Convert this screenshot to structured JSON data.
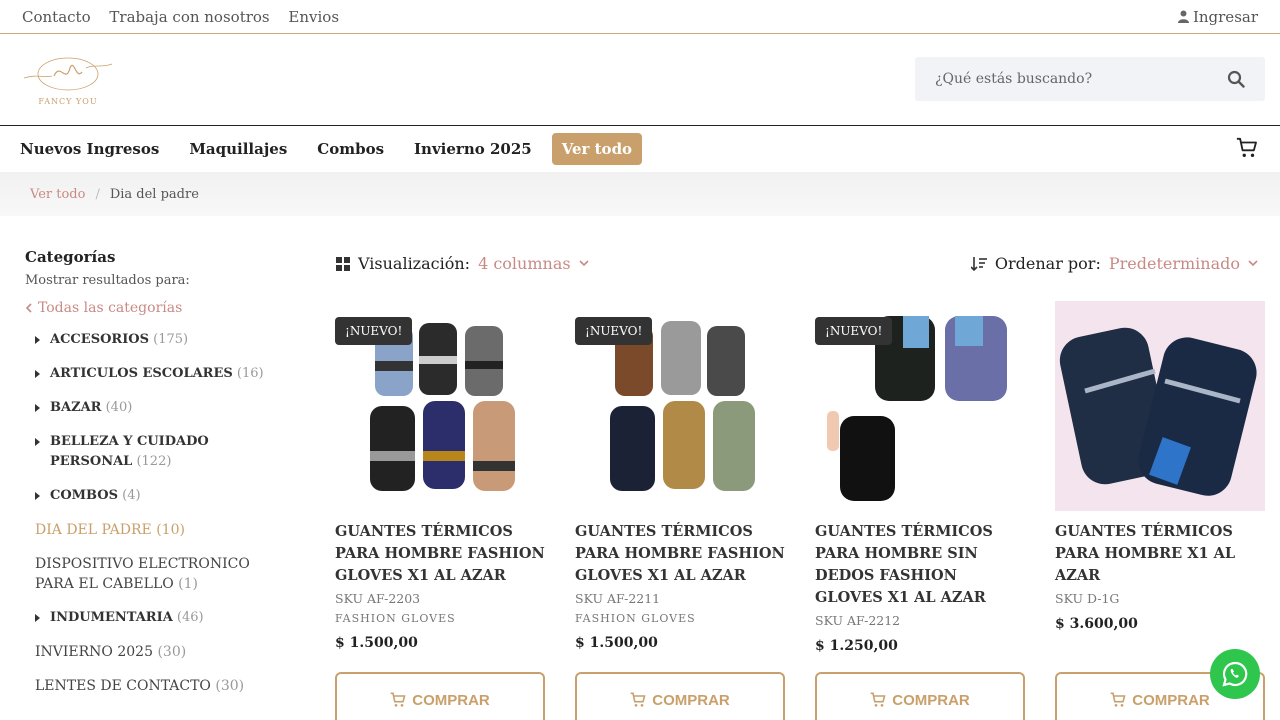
{
  "topbar": {
    "links": [
      "Contacto",
      "Trabaja con nosotros",
      "Envios"
    ],
    "login_label": "Ingresar"
  },
  "header": {
    "logo_text": "FANCY YOU",
    "search_placeholder": "¿Qué estás buscando?"
  },
  "nav": {
    "items": [
      "Nuevos Ingresos",
      "Maquillajes",
      "Combos",
      "Invierno 2025"
    ],
    "highlight": "Ver todo"
  },
  "breadcrumb": {
    "link": "Ver todo",
    "separator": "/",
    "current": "Dia del padre"
  },
  "sidebar": {
    "title": "Categorías",
    "subtitle": "Mostrar resultados para:",
    "all_label": "Todas las categorías",
    "categories": [
      {
        "name": "ACCESORIOS",
        "count": "(175)"
      },
      {
        "name": "ARTICULOS ESCOLARES",
        "count": "(16)"
      },
      {
        "name": "BAZAR",
        "count": "(40)"
      },
      {
        "name": "BELLEZA Y CUIDADO PERSONAL",
        "count": "(122)"
      },
      {
        "name": "COMBOS",
        "count": "(4)"
      },
      {
        "name": "DIA DEL PADRE",
        "count": "(10)"
      },
      {
        "name": "DISPOSITIVO ELECTRONICO PARA EL CABELLO",
        "count": "(1)"
      },
      {
        "name": "INDUMENTARIA",
        "count": "(46)"
      },
      {
        "name": "INVIERNO 2025",
        "count": "(30)"
      },
      {
        "name": "LENTES DE CONTACTO",
        "count": "(30)"
      }
    ]
  },
  "toolbar": {
    "view_label": "Visualización:",
    "view_value": "4 columnas",
    "order_label": "Ordenar por:",
    "order_value": "Predeterminado"
  },
  "products": [
    {
      "badge": "¡NUEVO!",
      "name": "GUANTES TÉRMICOS PARA HOMBRE FASHION GLOVES X1 AL AZAR",
      "sku": "SKU AF-2203",
      "brand": "FASHION GLOVES",
      "price": "$  1.500,00"
    },
    {
      "badge": "¡NUEVO!",
      "name": "GUANTES TÉRMICOS PARA HOMBRE FASHION GLOVES X1 AL AZAR",
      "sku": "SKU AF-2211",
      "brand": "FASHION GLOVES",
      "price": "$  1.500,00"
    },
    {
      "badge": "¡NUEVO!",
      "name": "GUANTES TÉRMICOS PARA HOMBRE SIN DEDOS FASHION GLOVES X1 AL AZAR",
      "sku": "SKU AF-2212",
      "brand": "",
      "price": "$  1.250,00"
    },
    {
      "badge": "",
      "name": "GUANTES TÉRMICOS PARA HOMBRE X1 AL AZAR",
      "sku": "SKU D-1G",
      "brand": "",
      "price": "$  3.600,00"
    }
  ],
  "buy_label": "COMPRAR",
  "colors": {
    "accent": "#c9a06b",
    "link": "#c98a85",
    "whatsapp": "#2fc64d"
  }
}
